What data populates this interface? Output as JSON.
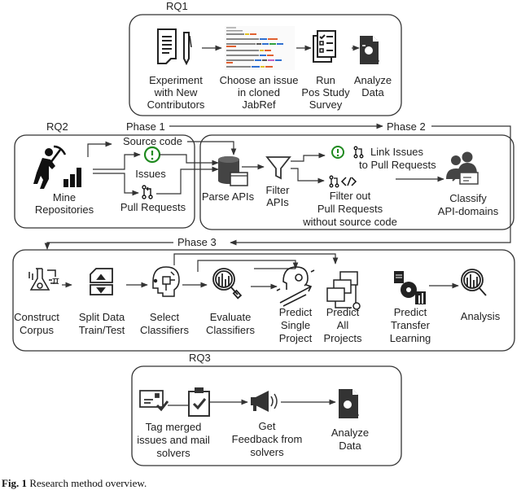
{
  "sections": {
    "rq1": "RQ1",
    "rq2": "RQ2",
    "rq3": "RQ3",
    "phase1": "Phase 1",
    "phase2": "Phase 2",
    "phase3": "Phase 3"
  },
  "rq1": {
    "steps": [
      {
        "icon": "document-pen-icon",
        "lines": [
          "Experiment",
          "with New",
          "Contributors"
        ]
      },
      {
        "icon": "issue-list-screenshot",
        "lines": [
          "Choose an issue",
          "in cloned",
          "JabRef"
        ]
      },
      {
        "icon": "checklist-icon",
        "lines": [
          "Run",
          "Pos Study",
          "Survey"
        ]
      },
      {
        "icon": "analyze-document-icon",
        "lines": [
          "Analyze",
          "Data"
        ]
      }
    ]
  },
  "phase1": {
    "mine": {
      "icon": "miner-icon",
      "lines": [
        "Mine",
        "Repositories"
      ]
    },
    "source_code": "Source code",
    "issues": {
      "icon": "issue-icon",
      "label": "Issues"
    },
    "pull_requests": {
      "icon": "pull-request-icon",
      "label": "Pull Requests"
    }
  },
  "phase2": {
    "parse": {
      "icon": "database-window-icon",
      "label": "Parse APIs"
    },
    "filter": {
      "icon": "funnel-icon",
      "lines": [
        "Filter",
        "APIs"
      ]
    },
    "link": {
      "icons": [
        "issue-icon",
        "pull-request-icon"
      ],
      "lines": [
        "Link Issues",
        "to Pull Requests"
      ]
    },
    "filter_out": {
      "icons": [
        "pull-request-icon",
        "code-icon"
      ],
      "lines": [
        "Filter out",
        "Pull Requests",
        "without source code"
      ]
    },
    "classify": {
      "icon": "users-mail-icon",
      "lines": [
        "Classify",
        "API-domains"
      ]
    }
  },
  "phase3": {
    "steps": [
      {
        "icon": "flask-circuit-icon",
        "lines": [
          "Construct",
          "Corpus"
        ]
      },
      {
        "icon": "split-data-icon",
        "lines": [
          "Split Data",
          "Train/Test"
        ]
      },
      {
        "icon": "ai-head-icon",
        "lines": [
          "Select",
          "Classifiers"
        ]
      },
      {
        "icon": "chart-magnifier-icon",
        "lines": [
          "Evaluate",
          "Classifiers"
        ]
      },
      {
        "icon": "head-gear-arrow-icon",
        "lines": [
          "Predict",
          "Single",
          "Project"
        ]
      },
      {
        "icon": "windows-gear-icon",
        "lines": [
          "Predict",
          "All",
          "Projects"
        ]
      },
      {
        "icon": "docs-gear-chart-icon",
        "lines": [
          "Predict",
          "Transfer",
          "Learning"
        ]
      },
      {
        "icon": "chart-magnifier-icon",
        "lines": [
          "Analysis"
        ]
      }
    ]
  },
  "rq3": {
    "steps": [
      {
        "icons": [
          "mail-check-icon",
          "clipboard-check-icon"
        ],
        "lines": [
          "Tag merged",
          "issues and mail",
          "solvers"
        ]
      },
      {
        "icon": "megaphone-icon",
        "lines": [
          "Get",
          "Feedback from",
          "solvers"
        ]
      },
      {
        "icon": "analyze-document-icon",
        "lines": [
          "Analyze",
          "Data"
        ]
      }
    ]
  },
  "caption": {
    "label": "Fig. 1",
    "text": "Research method overview."
  },
  "colors": {
    "issue_green": "#1f8a1f",
    "icon_dark": "#333333",
    "line": "#333333"
  }
}
